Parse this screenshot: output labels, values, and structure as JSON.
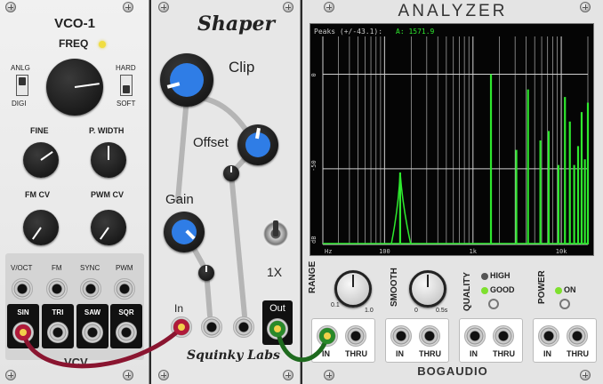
{
  "vco": {
    "title": "VCO-1",
    "freq_label": "FREQ",
    "switch1_top": "ANLG",
    "switch1_bottom": "DIGI",
    "switch2_top": "HARD",
    "switch2_bottom": "SOFT",
    "fine_label": "FINE",
    "pwidth_label": "P. WIDTH",
    "fmcv_label": "FM CV",
    "pwmcv_label": "PWM CV",
    "inputs": [
      "V/OCT",
      "FM",
      "SYNC",
      "PWM"
    ],
    "outputs": [
      "SIN",
      "TRI",
      "SAW",
      "SQR"
    ],
    "footer": "VCV"
  },
  "shaper": {
    "title": "Shaper",
    "clip_label": "Clip",
    "offset_label": "Offset",
    "gain_label": "Gain",
    "mode_label": "1X",
    "in_label": "In",
    "out_label": "Out",
    "brand": "Squinky Labs"
  },
  "analyzer": {
    "title": "ANALYZER",
    "peaks_text": "Peaks (+/-43.1):",
    "peak_value": "A: 1571.9",
    "y_ticks": [
      "0",
      "-50",
      "dB"
    ],
    "x_ticks": [
      "Hz",
      "100",
      "1k",
      "10k"
    ],
    "range_label": "RANGE",
    "range_min": "0.1",
    "range_max": "1.0",
    "smooth_label": "SMOOTH",
    "smooth_min": "0",
    "smooth_max": "0.5s",
    "quality_label": "QUALITY",
    "quality_high": "HIGH",
    "quality_good": "GOOD",
    "power_label": "POWER",
    "power_on": "ON",
    "in_label": "IN",
    "thru_label": "THRU",
    "brand": "BOGAUDIO",
    "colors": {
      "trace": "#2ee82e",
      "bg": "#050505",
      "grid": "#cfcfcf"
    }
  },
  "spectrum": {
    "peaks": [
      {
        "freq": 150,
        "level": -52
      },
      {
        "freq": 1600,
        "level": 0
      },
      {
        "freq": 3100,
        "level": -40
      },
      {
        "freq": 4200,
        "level": -8
      },
      {
        "freq": 5800,
        "level": -35
      },
      {
        "freq": 7200,
        "level": -30
      },
      {
        "freq": 9300,
        "level": -48
      },
      {
        "freq": 11000,
        "level": -12
      },
      {
        "freq": 12500,
        "level": -25
      },
      {
        "freq": 14000,
        "level": -48
      },
      {
        "freq": 15500,
        "level": -38
      },
      {
        "freq": 17000,
        "level": -20
      },
      {
        "freq": 18500,
        "level": -45
      },
      {
        "freq": 20000,
        "level": -15
      }
    ]
  }
}
